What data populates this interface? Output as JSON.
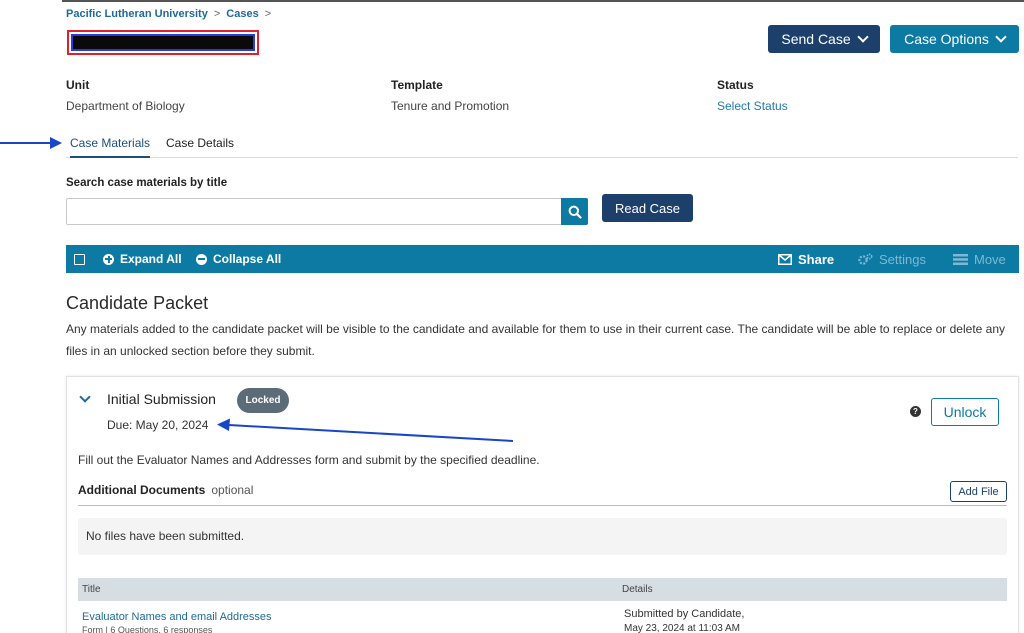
{
  "breadcrumb": {
    "items": [
      "Pacific Lutheran University",
      "Cases"
    ],
    "separator": ">"
  },
  "header": {
    "send_case_label": "Send Case",
    "case_options_label": "Case Options"
  },
  "meta": {
    "unit_label": "Unit",
    "unit_value": "Department of Biology",
    "template_label": "Template",
    "template_value": "Tenure and Promotion",
    "status_label": "Status",
    "status_value": "Select Status"
  },
  "tabs": [
    {
      "label": "Case Materials",
      "active": true
    },
    {
      "label": "Case Details",
      "active": false
    }
  ],
  "search": {
    "label": "Search case materials by title",
    "value": "",
    "placeholder": "",
    "read_case_label": "Read Case"
  },
  "toolbar": {
    "expand_all": "Expand All",
    "collapse_all": "Collapse All",
    "share": "Share",
    "settings": "Settings",
    "move": "Move"
  },
  "packet": {
    "title": "Candidate Packet",
    "description": "Any materials added to the candidate packet will be visible to the candidate and available for them to use in their current case. The candidate will be able to replace or delete any files in an unlocked section before they submit."
  },
  "section": {
    "title": "Initial Submission",
    "badge": "Locked",
    "due": "Due: May 20, 2024",
    "unlock_label": "Unlock",
    "help_glyph": "?",
    "instructions": "Fill out the Evaluator Names and Addresses form and submit by the specified deadline.",
    "addl_docs_label": "Additional Documents",
    "addl_docs_optional": "optional",
    "add_file_label": "Add File",
    "empty_message": "No files have been submitted."
  },
  "table": {
    "headers": {
      "title": "Title",
      "details": "Details"
    },
    "rows": [
      {
        "title": "Evaluator Names and email Addresses",
        "subtitle": "Form | 6 Questions, 6 responses",
        "details_line1": "Submitted by Candidate,",
        "details_line2": "May 23, 2024 at 11:03 AM"
      }
    ]
  },
  "colors": {
    "navy": "#1d3f6b",
    "teal": "#0d7aa4",
    "link": "#1f7ab0",
    "annotation_arrow": "#1846c9",
    "redaction_border": "#e02030"
  },
  "icons": [
    "chevron-down-icon",
    "search-icon",
    "plus-circle-icon",
    "minus-circle-icon",
    "envelope-icon",
    "gear-icon",
    "move-icon",
    "help-icon",
    "annotation-arrow-icon"
  ]
}
